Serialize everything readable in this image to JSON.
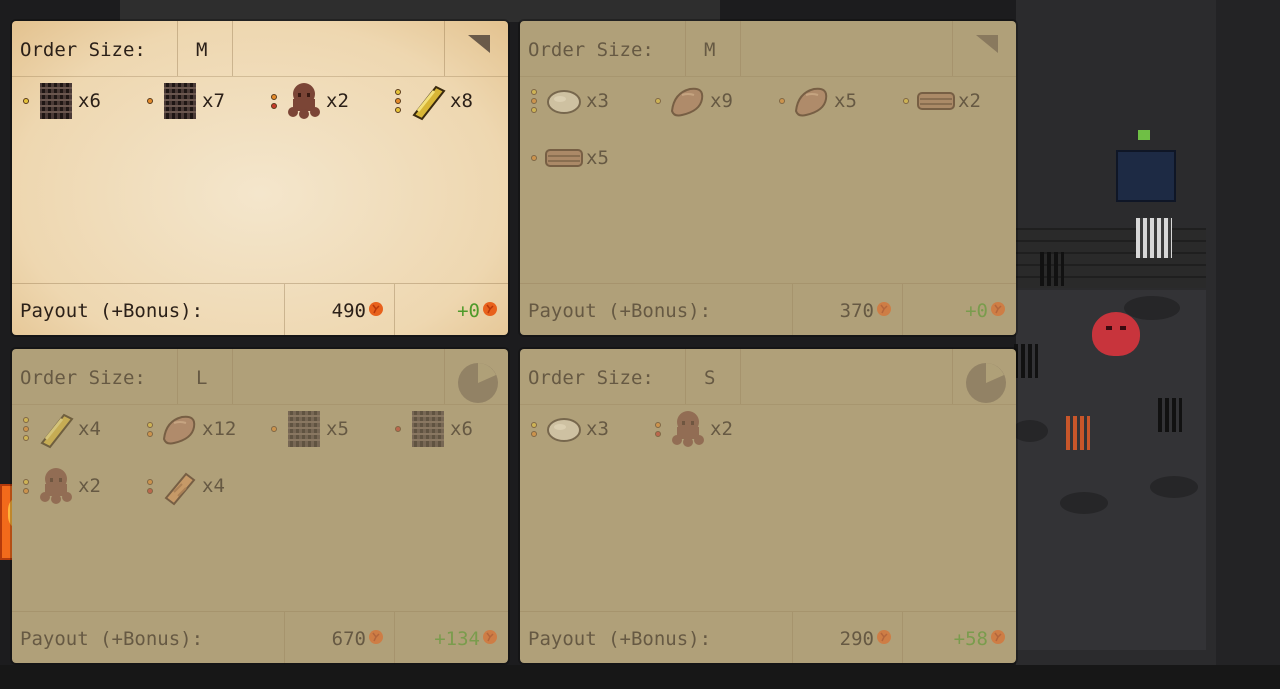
{
  "orders": [
    {
      "size_label": "Order Size:",
      "size": "M",
      "payout_label": "Payout (+Bonus):",
      "payout": "490",
      "bonus": "+0",
      "items": [
        {
          "icon": "coil-icon",
          "dots": [
            "y"
          ],
          "qty": "x6"
        },
        {
          "icon": "coil-icon",
          "dots": [
            "o"
          ],
          "qty": "x7"
        },
        {
          "icon": "octopus-icon",
          "dots": [
            "o",
            "r"
          ],
          "qty": "x2"
        },
        {
          "icon": "gold-bar-icon",
          "dots": [
            "y",
            "o",
            "y"
          ],
          "qty": "x8"
        }
      ]
    },
    {
      "size_label": "Order Size:",
      "size": "M",
      "payout_label": "Payout (+Bonus):",
      "payout": "370",
      "bonus": "+0",
      "items": [
        {
          "icon": "rock-icon",
          "dots": [
            "y",
            "o",
            "y"
          ],
          "qty": "x3"
        },
        {
          "icon": "meat-icon",
          "dots": [
            "y"
          ],
          "qty": "x9"
        },
        {
          "icon": "meat-icon",
          "dots": [
            "o"
          ],
          "qty": "x5"
        },
        {
          "icon": "rope-icon",
          "dots": [
            "y"
          ],
          "qty": "x2"
        },
        {
          "icon": "rope-icon",
          "dots": [
            "o"
          ],
          "qty": "x5"
        }
      ]
    },
    {
      "size_label": "Order Size:",
      "size": "L",
      "payout_label": "Payout (+Bonus):",
      "payout": "670",
      "bonus": "+134",
      "items": [
        {
          "icon": "gold-bar-icon",
          "dots": [
            "y",
            "o",
            "y"
          ],
          "qty": "x4"
        },
        {
          "icon": "meat-icon",
          "dots": [
            "y",
            "o"
          ],
          "qty": "x12"
        },
        {
          "icon": "coil-icon",
          "dots": [
            "o"
          ],
          "qty": "x5"
        },
        {
          "icon": "coil-icon",
          "dots": [
            "r"
          ],
          "qty": "x6"
        },
        {
          "icon": "octopus-icon",
          "dots": [
            "y",
            "o"
          ],
          "qty": "x2"
        },
        {
          "icon": "plank-icon",
          "dots": [
            "o",
            "r"
          ],
          "qty": "x4"
        }
      ]
    },
    {
      "size_label": "Order Size:",
      "size": "S",
      "payout_label": "Payout (+Bonus):",
      "payout": "290",
      "bonus": "+58",
      "items": [
        {
          "icon": "rock-icon",
          "dots": [
            "y",
            "o"
          ],
          "qty": "x3"
        },
        {
          "icon": "octopus-icon",
          "dots": [
            "o",
            "r"
          ],
          "qty": "x2"
        }
      ]
    }
  ],
  "colors": {
    "bonus_green": "#4f9a2a",
    "coin_orange": "#e8611c"
  }
}
